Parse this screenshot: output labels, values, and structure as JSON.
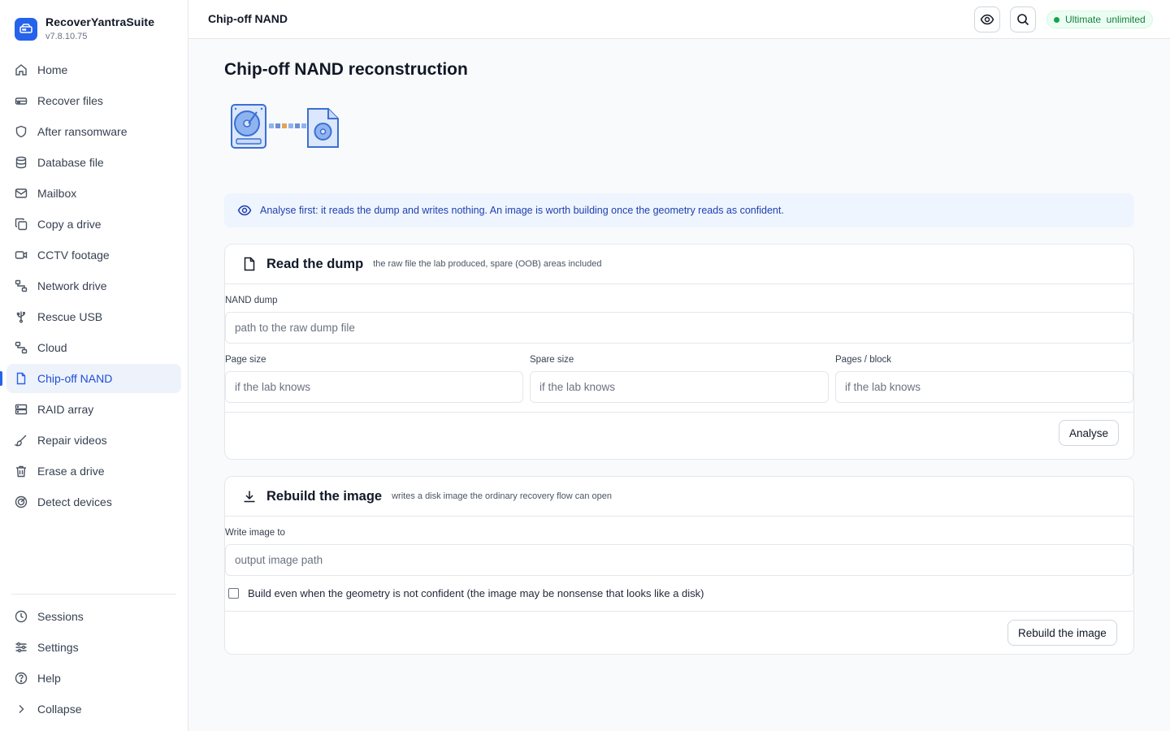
{
  "app": {
    "name": "RecoverYantraSuite",
    "version": "v7.8.10.75"
  },
  "nav": {
    "items": [
      {
        "label": "Home",
        "icon": "home-icon"
      },
      {
        "label": "Recover files",
        "icon": "hard-drive-icon"
      },
      {
        "label": "After ransomware",
        "icon": "shield-icon"
      },
      {
        "label": "Database file",
        "icon": "database-icon"
      },
      {
        "label": "Mailbox",
        "icon": "mail-icon"
      },
      {
        "label": "Copy a drive",
        "icon": "copy-icon"
      },
      {
        "label": "CCTV footage",
        "icon": "video-icon"
      },
      {
        "label": "Network drive",
        "icon": "network-icon"
      },
      {
        "label": "Rescue USB",
        "icon": "usb-icon"
      },
      {
        "label": "Cloud",
        "icon": "network-icon"
      },
      {
        "label": "Chip-off NAND",
        "icon": "file-icon",
        "active": true
      },
      {
        "label": "RAID array",
        "icon": "server-icon"
      },
      {
        "label": "Repair videos",
        "icon": "brush-icon"
      },
      {
        "label": "Erase a drive",
        "icon": "trash-icon"
      },
      {
        "label": "Detect devices",
        "icon": "radar-icon"
      }
    ],
    "bottom": [
      {
        "label": "Sessions",
        "icon": "clock-icon"
      },
      {
        "label": "Settings",
        "icon": "sliders-icon"
      },
      {
        "label": "Help",
        "icon": "help-icon"
      },
      {
        "label": "Collapse",
        "icon": "chevron-right-icon"
      }
    ]
  },
  "topbar": {
    "breadcrumb": "Chip-off NAND",
    "license": "Ultimate  unlimited"
  },
  "page": {
    "title": "Chip-off NAND reconstruction"
  },
  "notice": {
    "text": "Analyse first: it reads the dump and writes nothing. An image is worth building once the geometry reads as confident."
  },
  "read_card": {
    "title": "Read the dump",
    "subtitle": "the raw file the lab produced, spare (OOB) areas included",
    "dump_label": "NAND dump",
    "dump_placeholder": "path to the raw dump file",
    "page_size_label": "Page size",
    "spare_size_label": "Spare size",
    "pages_block_label": "Pages / block",
    "unknown_placeholder": "if the lab knows",
    "analyse_button": "Analyse"
  },
  "rebuild_card": {
    "title": "Rebuild the image",
    "subtitle": "writes a disk image the ordinary recovery flow can open",
    "output_label": "Write image to",
    "output_placeholder": "output image path",
    "force_label": "Build even when the geometry is not confident (the image may be nonsense that looks like a disk)",
    "rebuild_button": "Rebuild the image"
  },
  "colors": {
    "accent": "#2563eb",
    "notice_bg": "#eff5ff",
    "license_green": "#16a34a"
  }
}
